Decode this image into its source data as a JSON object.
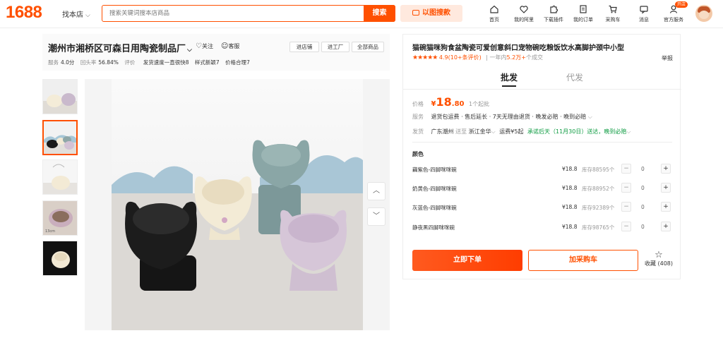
{
  "brand": {
    "logo": "1688",
    "accent": "#ff5000"
  },
  "header": {
    "find_shop": "找本店",
    "search_placeholder": "搜索关键词搜本店商品",
    "search_button": "搜索",
    "image_search": "以图搜款",
    "nav": [
      {
        "label": "首页",
        "icon": "home-icon"
      },
      {
        "label": "我的阿里",
        "icon": "heart-shield-icon"
      },
      {
        "label": "下载插件",
        "icon": "puzzle-icon"
      },
      {
        "label": "我的订单",
        "icon": "order-icon"
      },
      {
        "label": "采购车",
        "icon": "cart-icon"
      },
      {
        "label": "消息",
        "icon": "message-icon"
      },
      {
        "label": "官方服务",
        "icon": "service-icon"
      }
    ],
    "open_badge": "开店"
  },
  "shop": {
    "name": "潮州市湘桥区可森日用陶瓷制品厂",
    "follow": "关注",
    "service": "客服",
    "buttons": [
      "进店铺",
      "进工厂",
      "全部商品"
    ],
    "stats": [
      {
        "label": "服务",
        "value": "4.0分"
      },
      {
        "label": "回头率",
        "value": "56.84%"
      },
      {
        "label": "评价",
        "value": ""
      },
      {
        "label": "发货速度一直很快",
        "value": "8"
      },
      {
        "label": "样式新颖",
        "value": "7"
      },
      {
        "label": "价格合理",
        "value": "7"
      }
    ]
  },
  "product": {
    "title": "猫碗猫咪狗食盆陶瓷可爱创意斜口宠物碗吃粮饭饮水高脚护颈中小型",
    "rating_stars": "★★★★★",
    "rating_score": "4.9",
    "review_count": "(10+条评价)",
    "sales_prefix": "一年内",
    "sales_count": "5.2万+",
    "sales_suffix": "个成交",
    "report": "举报",
    "tabs": [
      "批发",
      "代发"
    ],
    "price_label": "价格",
    "price_symbol": "¥",
    "price_int": "18",
    "price_dec": ".80",
    "moq": "1个起批",
    "service_label": "服务",
    "service_text": "退货包运费 · 售后延长 · 7天无理由退货 · 晚发必赔 · 晚到必赔",
    "ship_label": "发货",
    "ship_from": "广东潮州",
    "ship_to_prefix": "送至",
    "ship_to": "浙江金华",
    "ship_fee": "运费¥5起",
    "ship_promise": "承诺后天（11月30日）送达，晚到必赔",
    "color_label": "颜色",
    "skus": [
      {
        "name": "藕紫色-四脚咪咪碗",
        "price": "¥18.8",
        "stock": "库存88595个",
        "qty": "0"
      },
      {
        "name": "奶黄色-四脚咪咪碗",
        "price": "¥18.8",
        "stock": "库存88952个",
        "qty": "0"
      },
      {
        "name": "灰蓝色-四脚咪咪碗",
        "price": "¥18.8",
        "stock": "库存92389个",
        "qty": "0"
      },
      {
        "name": "静夜黑四脚咪咪碗",
        "price": "¥18.8",
        "stock": "库存98765个",
        "qty": "0"
      }
    ],
    "buy_now": "立即下单",
    "add_cart": "加采购车",
    "favorite": "收藏 (408)"
  }
}
